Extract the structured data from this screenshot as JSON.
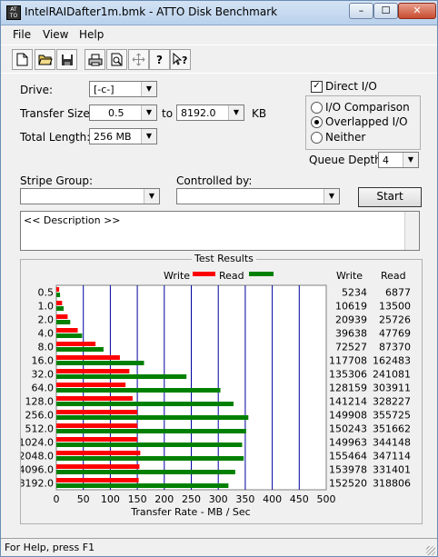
{
  "window": {
    "title": "IntelRAIDafter1m.bmk - ATTO Disk Benchmark",
    "minimize": "–",
    "maximize": "☐",
    "close": "✕"
  },
  "menu": [
    "File",
    "View",
    "Help"
  ],
  "toolbar": {
    "icons": [
      "new-file-icon",
      "open-folder-icon",
      "save-icon",
      "print-icon",
      "print-preview-icon",
      "move-icon",
      "help-icon",
      "context-help-icon"
    ]
  },
  "settings": {
    "drive_label": "Drive:",
    "drive_value": "[-c-]",
    "transfer_size_label": "Transfer Size:",
    "transfer_from": "0.5",
    "to_label": "to",
    "transfer_to": "8192.0",
    "unit_label": "KB",
    "total_length_label": "Total Length:",
    "total_length_value": "256 MB",
    "direct_io_label": "Direct I/O",
    "direct_io_checked": true,
    "io_comparison_label": "I/O Comparison",
    "overlapped_io_label": "Overlapped I/O",
    "neither_label": "Neither",
    "io_mode_selected": "Overlapped I/O",
    "queue_depth_label": "Queue Depth:",
    "queue_depth_value": "4",
    "stripe_group_label": "Stripe Group:",
    "stripe_group_value": "",
    "controlled_by_label": "Controlled by:",
    "controlled_by_value": "",
    "start_label": "Start",
    "description_text": "<< Description >>"
  },
  "status_bar": "For Help, press F1",
  "colors": {
    "write": "#ff0000",
    "read": "#008000",
    "grid": "#0000a0"
  },
  "chart_data": {
    "type": "bar",
    "title": "Test Results",
    "xlabel": "Transfer Rate - MB / Sec",
    "ylabel": "",
    "xlim": [
      0,
      500
    ],
    "xticks": [
      0,
      50,
      100,
      150,
      200,
      250,
      300,
      350,
      400,
      450,
      500
    ],
    "categories": [
      "0.5",
      "1.0",
      "2.0",
      "4.0",
      "8.0",
      "16.0",
      "32.0",
      "64.0",
      "128.0",
      "256.0",
      "512.0",
      "1024.0",
      "2048.0",
      "4096.0",
      "8192.0"
    ],
    "legend": [
      "Write",
      "Read"
    ],
    "column_headers": [
      "Write",
      "Read"
    ],
    "series": [
      {
        "name": "Write",
        "values": [
          5234,
          10619,
          20939,
          39638,
          72527,
          117708,
          135306,
          128159,
          141214,
          149908,
          150243,
          149963,
          155464,
          153978,
          152520
        ]
      },
      {
        "name": "Read",
        "values": [
          6877,
          13500,
          25726,
          47769,
          87370,
          162483,
          241081,
          303911,
          328227,
          355725,
          351662,
          344148,
          347114,
          331401,
          318806
        ]
      }
    ]
  }
}
